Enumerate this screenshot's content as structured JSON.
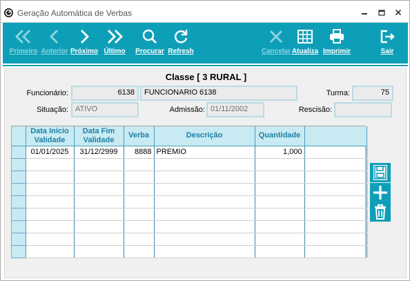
{
  "window": {
    "title": "Geração Automática de Verbas"
  },
  "icons": {
    "app": "app-logo-icon",
    "minimize": "minimize-icon",
    "maximize": "maximize-icon",
    "close": "close-icon"
  },
  "toolbar": {
    "first": {
      "label": "Primeiro",
      "icon": "double-chevron-left-icon",
      "enabled": false
    },
    "prev": {
      "label": "Anterior",
      "icon": "chevron-left-icon",
      "enabled": false
    },
    "next": {
      "label": "Próximo",
      "icon": "chevron-right-icon",
      "enabled": true
    },
    "last": {
      "label": "Último",
      "icon": "double-chevron-right-icon",
      "enabled": true
    },
    "search": {
      "label": "Procurar",
      "icon": "search-icon",
      "enabled": true
    },
    "refresh": {
      "label": "Refresh",
      "icon": "refresh-icon",
      "enabled": true
    },
    "cancel": {
      "label": "Cancelar",
      "icon": "x-icon",
      "enabled": false
    },
    "update": {
      "label": "Atualiza",
      "icon": "grid-icon",
      "enabled": true
    },
    "print": {
      "label": "Imprimir",
      "icon": "printer-icon",
      "enabled": true
    },
    "exit": {
      "label": "Sair",
      "icon": "exit-icon",
      "enabled": true
    }
  },
  "form": {
    "classe": "Classe [ 3 RURAL ]",
    "funcionario_label": "Funcionário:",
    "funcionario_code": "6138",
    "funcionario_name": "FUNCIONARIO 6138",
    "turma_label": "Turma:",
    "turma_value": "75",
    "situacao_label": "Situação:",
    "situacao_value": "ATIVO",
    "admissao_label": "Admissão:",
    "admissao_value": "01/11/2002",
    "rescisao_label": "Rescisão:",
    "rescisao_value": ""
  },
  "grid": {
    "headers": {
      "data_inicio_1": "Data Início",
      "data_inicio_2": "Validade",
      "data_fim_1": "Data Fim",
      "data_fim_2": "Validade",
      "verba": "Verba",
      "descricao": "Descrição",
      "quantidade": "Quantidade"
    },
    "rows": [
      {
        "data_inicio": "01/01/2025",
        "data_fim": "31/12/2999",
        "verba": "8888",
        "descricao": "PREMIO",
        "quantidade": "1,000"
      }
    ],
    "empty_rows": 8
  },
  "side_actions": {
    "save": "save-icon",
    "add": "plus-icon",
    "delete": "trash-icon"
  },
  "colors": {
    "accent": "#0e9fb8",
    "header_bg": "#c8eaf3",
    "header_text": "#1c7fa6",
    "disabled_label": "#8fd3df"
  }
}
